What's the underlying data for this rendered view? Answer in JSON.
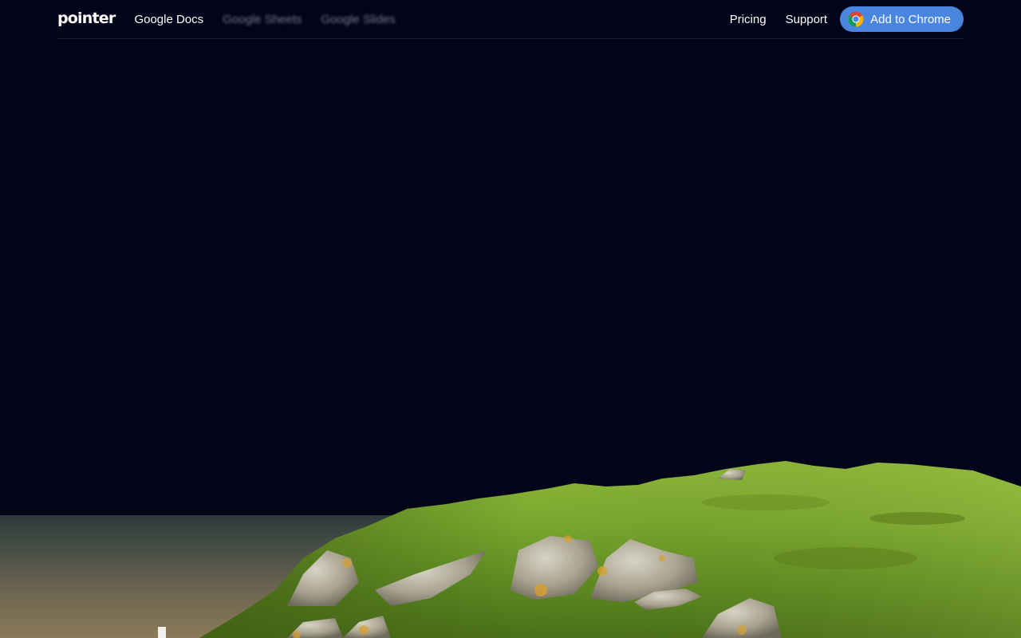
{
  "navbar": {
    "logo": "pointer",
    "links": [
      {
        "label": "Google Docs",
        "blurred": false
      },
      {
        "label": "Google Sheets",
        "blurred": true
      },
      {
        "label": "Google Slides",
        "blurred": true
      }
    ],
    "right_links": [
      {
        "label": "Pricing"
      },
      {
        "label": "Support"
      }
    ],
    "cta": {
      "label": "Add to Chrome",
      "icon": "chrome-icon",
      "color": "#4a86e0"
    }
  },
  "hero": {
    "background_color": "#03031a",
    "image": "grassy-hill-landscape"
  }
}
